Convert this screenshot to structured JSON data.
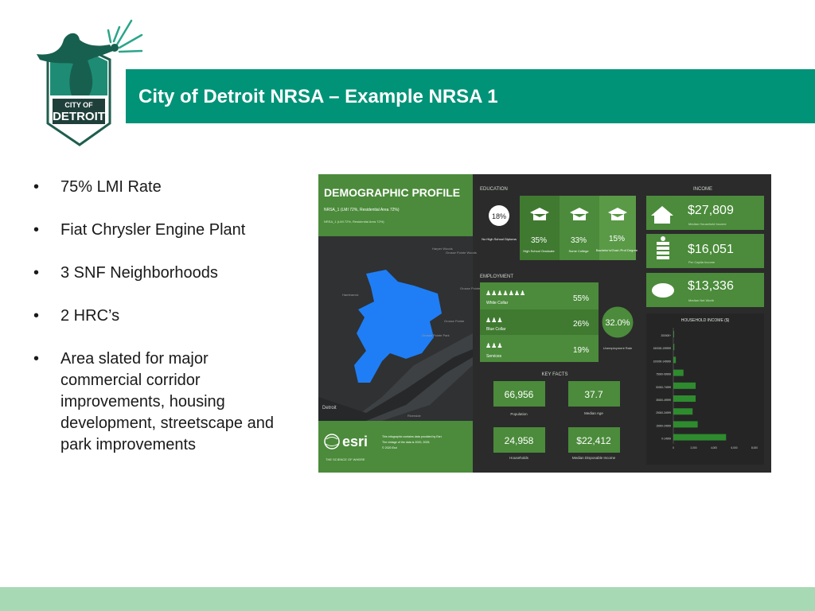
{
  "colors": {
    "brand": "#009378",
    "footer": "#a7d9b5",
    "panel_green": "#4b8b3b",
    "panel_dark": "#2b2b2b"
  },
  "logo": {
    "line1": "CITY OF",
    "line2": "DETROIT"
  },
  "slide": {
    "title": "City of Detroit NRSA – Example NRSA 1"
  },
  "bullets": [
    {
      "marker": "•",
      "text": "75% LMI Rate"
    },
    {
      "marker": "•",
      "text": "Fiat Chrysler Engine Plant"
    },
    {
      "marker": "•",
      "text": "3 SNF Neighborhoods"
    },
    {
      "marker": "•",
      "text": "2 HRC’s"
    },
    {
      "marker": "•",
      "text": "Area slated for major commercial corridor improvements, housing development, streetscape and park improvements"
    }
  ],
  "infographic": {
    "title": "DEMOGRAPHIC PROFILE",
    "subtitle": "NRSA_1 (LMI 72%, Residential Area 72%)",
    "subtitle2": "NRSA_1 (LMI 72%, Residential Area 72%)",
    "map_labels": [
      "Harper Woods",
      "Grosse Pointe Woods",
      "Grosse Pointe Farms",
      "Grosse Pointe",
      "Grosse Pointe Park",
      "Hamtramck",
      "Detroit",
      "Riverside"
    ],
    "education": {
      "heading": "EDUCATION",
      "items": [
        {
          "pct": "18%",
          "label": "No High School Diploma"
        },
        {
          "pct": "35%",
          "label": "High School Graduate"
        },
        {
          "pct": "33%",
          "label": "Some College"
        },
        {
          "pct": "15%",
          "label": "Bachelor's/Grad /Prof Degree"
        }
      ]
    },
    "employment": {
      "heading": "EMPLOYMENT",
      "rows": [
        {
          "label": "White Collar",
          "pct": "55%"
        },
        {
          "label": "Blue Collar",
          "pct": "26%"
        },
        {
          "label": "Services",
          "pct": "19%"
        }
      ],
      "unemployment": {
        "value": "32.0%",
        "label": "Unemployment Rate"
      }
    },
    "key_facts": {
      "heading": "KEY FACTS",
      "items": [
        {
          "value": "66,956",
          "label": "Population"
        },
        {
          "value": "37.7",
          "label": "Median Age"
        },
        {
          "value": "24,958",
          "label": "Households"
        },
        {
          "value": "$22,412",
          "label": "Median Disposable Income"
        }
      ]
    },
    "income": {
      "heading": "INCOME",
      "items": [
        {
          "value": "$27,809",
          "label": "Median Household Income"
        },
        {
          "value": "$16,051",
          "label": "Per Capita Income"
        },
        {
          "value": "$13,336",
          "label": "Median Net Worth"
        }
      ]
    },
    "esri": {
      "name": "esri",
      "tagline": "THE SCIENCE OF WHERE",
      "note1": "This infographic contains data provided by Esri.",
      "note2": "The vintage of the data is 2020, 2025.",
      "note3": "© 2020 Esri"
    }
  },
  "chart_data": {
    "type": "bar",
    "orientation": "horizontal",
    "title": "HOUSEHOLD INCOME ($)",
    "categories": [
      "200000+",
      "150000-199999",
      "100000-149999",
      "75000-99999",
      "50000-74999",
      "35000-49999",
      "25000-34999",
      "15000-24999",
      "0-14999"
    ],
    "values": [
      60,
      100,
      250,
      1000,
      2200,
      2200,
      1900,
      2400,
      5200
    ],
    "xticks": [
      "0",
      "2,000",
      "4,000",
      "6,000",
      "8,000"
    ],
    "xlim": [
      0,
      8000
    ],
    "legend": "none",
    "bar_color": "#2e8b2e"
  }
}
